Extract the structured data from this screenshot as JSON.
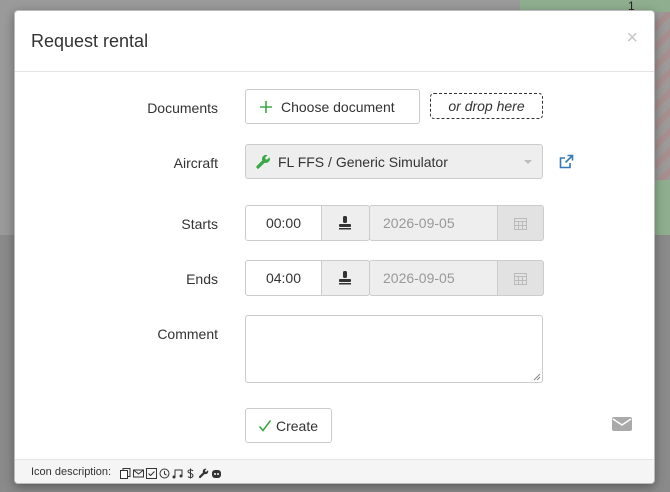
{
  "background": {
    "corner_number": "1"
  },
  "modal": {
    "title": "Request rental",
    "close_symbol": "×"
  },
  "form": {
    "documents": {
      "label": "Documents",
      "choose_button": "Choose document",
      "drop_hint": "or drop here"
    },
    "aircraft": {
      "label": "Aircraft",
      "selected": "FL FFS / Generic Simulator",
      "icon": "wrench-icon",
      "icon_color": "#3aa845"
    },
    "starts": {
      "label": "Starts",
      "time": "00:00",
      "date_placeholder": "2026-09-05"
    },
    "ends": {
      "label": "Ends",
      "time": "04:00",
      "date_placeholder": "2026-09-05"
    },
    "comment": {
      "label": "Comment",
      "value": ""
    },
    "create_button": "Create"
  },
  "footer": {
    "icon_description_label": "Icon description:",
    "icons": [
      "documents-icon",
      "mail-icon",
      "checkbox-icon",
      "history-icon",
      "music-icon",
      "dollar-icon",
      "wrench-icon",
      "robot-icon"
    ]
  },
  "colors": {
    "accent_green": "#3aa845",
    "link_blue": "#337ab7"
  }
}
